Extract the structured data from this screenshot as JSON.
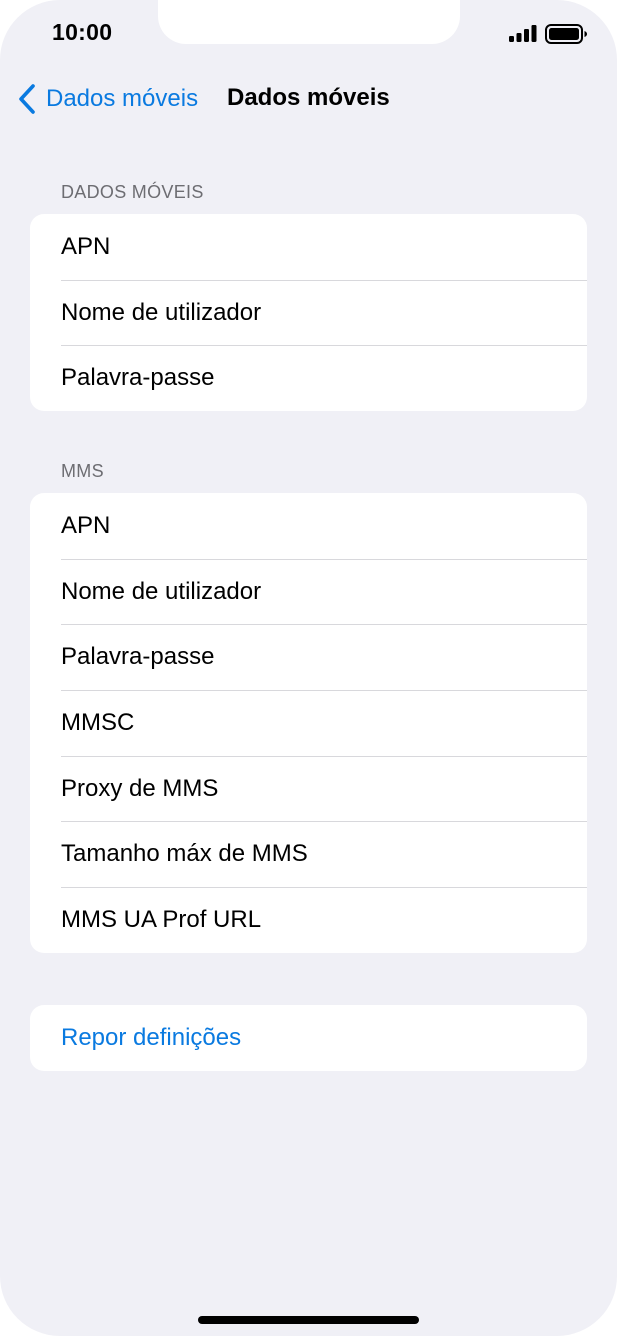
{
  "status_bar": {
    "time": "10:00"
  },
  "nav": {
    "back_label": "Dados móveis",
    "title": "Dados móveis"
  },
  "sections": {
    "mobile_data": {
      "header": "DADOS MÓVEIS",
      "rows": [
        "APN",
        "Nome de utilizador",
        "Palavra-passe"
      ]
    },
    "mms": {
      "header": "MMS",
      "rows": [
        "APN",
        "Nome de utilizador",
        "Palavra-passe",
        "MMSC",
        "Proxy de MMS",
        "Tamanho máx de MMS",
        "MMS UA Prof URL"
      ]
    },
    "reset": {
      "label": "Repor definições"
    }
  },
  "icons": {
    "back": "chevron-left-icon",
    "signal": "cellular-signal-icon",
    "battery": "battery-icon"
  },
  "colors": {
    "accent": "#0a7ae0",
    "background": "#f0f0f6",
    "card": "#ffffff",
    "section_header": "#6d6d72"
  }
}
